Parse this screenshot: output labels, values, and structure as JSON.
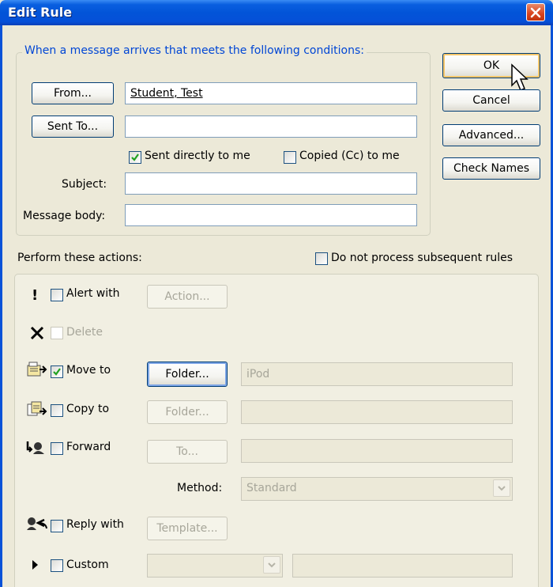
{
  "window": {
    "title": "Edit Rule"
  },
  "conditions": {
    "legend": "When a message arrives that meets the following conditions:",
    "from_button": "From...",
    "from_value": "Student, Test",
    "sent_to_button": "Sent To...",
    "sent_to_value": "",
    "sent_directly_label": "Sent directly to me",
    "sent_directly_checked": true,
    "copied_cc_label": "Copied (Cc) to me",
    "copied_cc_checked": false,
    "subject_label": "Subject:",
    "subject_value": "",
    "message_body_label": "Message body:",
    "message_body_value": ""
  },
  "side_buttons": {
    "ok": "OK",
    "cancel": "Cancel",
    "advanced": "Advanced...",
    "check_names": "Check Names"
  },
  "actions": {
    "title": "Perform these actions:",
    "do_not_process_label": "Do not process subsequent rules",
    "do_not_process_checked": false,
    "alert": {
      "label": "Alert with",
      "checked": false,
      "button": "Action..."
    },
    "delete": {
      "label": "Delete",
      "checked": false
    },
    "move": {
      "label": "Move to",
      "checked": true,
      "button": "Folder...",
      "value": "iPod"
    },
    "copy": {
      "label": "Copy to",
      "checked": false,
      "button": "Folder...",
      "value": ""
    },
    "forward": {
      "label": "Forward",
      "checked": false,
      "button": "To...",
      "value": ""
    },
    "method": {
      "label": "Method:",
      "value": "Standard"
    },
    "reply": {
      "label": "Reply with",
      "checked": false,
      "button": "Template..."
    },
    "custom": {
      "label": "Custom",
      "checked": false,
      "value": "",
      "text": ""
    }
  },
  "icons": {
    "alert": "exclamation-icon",
    "delete": "x-delete-icon",
    "move": "move-to-folder-icon",
    "copy": "copy-to-folder-icon",
    "forward": "forward-icon",
    "reply": "reply-icon",
    "custom": "triangle-right-icon"
  },
  "colors": {
    "title_bar": "#0254d8",
    "legend_text": "#0046d5",
    "check_mark": "#21a121",
    "close_button": "#d8431d"
  }
}
